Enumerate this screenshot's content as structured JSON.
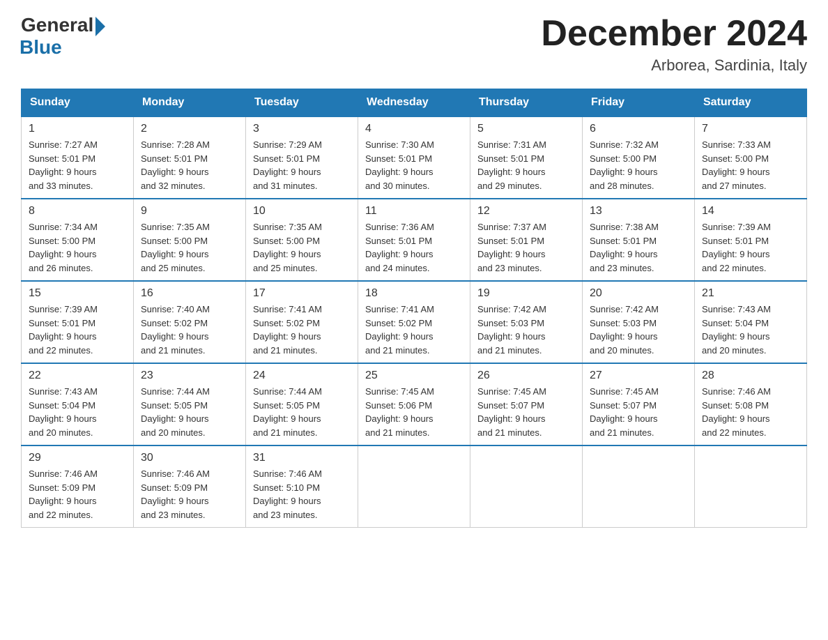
{
  "logo": {
    "general": "General",
    "blue": "Blue"
  },
  "header": {
    "month_year": "December 2024",
    "location": "Arborea, Sardinia, Italy"
  },
  "days_of_week": [
    "Sunday",
    "Monday",
    "Tuesday",
    "Wednesday",
    "Thursday",
    "Friday",
    "Saturday"
  ],
  "weeks": [
    [
      {
        "day": "1",
        "sunrise": "7:27 AM",
        "sunset": "5:01 PM",
        "daylight": "9 hours and 33 minutes."
      },
      {
        "day": "2",
        "sunrise": "7:28 AM",
        "sunset": "5:01 PM",
        "daylight": "9 hours and 32 minutes."
      },
      {
        "day": "3",
        "sunrise": "7:29 AM",
        "sunset": "5:01 PM",
        "daylight": "9 hours and 31 minutes."
      },
      {
        "day": "4",
        "sunrise": "7:30 AM",
        "sunset": "5:01 PM",
        "daylight": "9 hours and 30 minutes."
      },
      {
        "day": "5",
        "sunrise": "7:31 AM",
        "sunset": "5:01 PM",
        "daylight": "9 hours and 29 minutes."
      },
      {
        "day": "6",
        "sunrise": "7:32 AM",
        "sunset": "5:00 PM",
        "daylight": "9 hours and 28 minutes."
      },
      {
        "day": "7",
        "sunrise": "7:33 AM",
        "sunset": "5:00 PM",
        "daylight": "9 hours and 27 minutes."
      }
    ],
    [
      {
        "day": "8",
        "sunrise": "7:34 AM",
        "sunset": "5:00 PM",
        "daylight": "9 hours and 26 minutes."
      },
      {
        "day": "9",
        "sunrise": "7:35 AM",
        "sunset": "5:00 PM",
        "daylight": "9 hours and 25 minutes."
      },
      {
        "day": "10",
        "sunrise": "7:35 AM",
        "sunset": "5:00 PM",
        "daylight": "9 hours and 25 minutes."
      },
      {
        "day": "11",
        "sunrise": "7:36 AM",
        "sunset": "5:01 PM",
        "daylight": "9 hours and 24 minutes."
      },
      {
        "day": "12",
        "sunrise": "7:37 AM",
        "sunset": "5:01 PM",
        "daylight": "9 hours and 23 minutes."
      },
      {
        "day": "13",
        "sunrise": "7:38 AM",
        "sunset": "5:01 PM",
        "daylight": "9 hours and 23 minutes."
      },
      {
        "day": "14",
        "sunrise": "7:39 AM",
        "sunset": "5:01 PM",
        "daylight": "9 hours and 22 minutes."
      }
    ],
    [
      {
        "day": "15",
        "sunrise": "7:39 AM",
        "sunset": "5:01 PM",
        "daylight": "9 hours and 22 minutes."
      },
      {
        "day": "16",
        "sunrise": "7:40 AM",
        "sunset": "5:02 PM",
        "daylight": "9 hours and 21 minutes."
      },
      {
        "day": "17",
        "sunrise": "7:41 AM",
        "sunset": "5:02 PM",
        "daylight": "9 hours and 21 minutes."
      },
      {
        "day": "18",
        "sunrise": "7:41 AM",
        "sunset": "5:02 PM",
        "daylight": "9 hours and 21 minutes."
      },
      {
        "day": "19",
        "sunrise": "7:42 AM",
        "sunset": "5:03 PM",
        "daylight": "9 hours and 21 minutes."
      },
      {
        "day": "20",
        "sunrise": "7:42 AM",
        "sunset": "5:03 PM",
        "daylight": "9 hours and 20 minutes."
      },
      {
        "day": "21",
        "sunrise": "7:43 AM",
        "sunset": "5:04 PM",
        "daylight": "9 hours and 20 minutes."
      }
    ],
    [
      {
        "day": "22",
        "sunrise": "7:43 AM",
        "sunset": "5:04 PM",
        "daylight": "9 hours and 20 minutes."
      },
      {
        "day": "23",
        "sunrise": "7:44 AM",
        "sunset": "5:05 PM",
        "daylight": "9 hours and 20 minutes."
      },
      {
        "day": "24",
        "sunrise": "7:44 AM",
        "sunset": "5:05 PM",
        "daylight": "9 hours and 21 minutes."
      },
      {
        "day": "25",
        "sunrise": "7:45 AM",
        "sunset": "5:06 PM",
        "daylight": "9 hours and 21 minutes."
      },
      {
        "day": "26",
        "sunrise": "7:45 AM",
        "sunset": "5:07 PM",
        "daylight": "9 hours and 21 minutes."
      },
      {
        "day": "27",
        "sunrise": "7:45 AM",
        "sunset": "5:07 PM",
        "daylight": "9 hours and 21 minutes."
      },
      {
        "day": "28",
        "sunrise": "7:46 AM",
        "sunset": "5:08 PM",
        "daylight": "9 hours and 22 minutes."
      }
    ],
    [
      {
        "day": "29",
        "sunrise": "7:46 AM",
        "sunset": "5:09 PM",
        "daylight": "9 hours and 22 minutes."
      },
      {
        "day": "30",
        "sunrise": "7:46 AM",
        "sunset": "5:09 PM",
        "daylight": "9 hours and 23 minutes."
      },
      {
        "day": "31",
        "sunrise": "7:46 AM",
        "sunset": "5:10 PM",
        "daylight": "9 hours and 23 minutes."
      },
      null,
      null,
      null,
      null
    ]
  ],
  "labels": {
    "sunrise": "Sunrise:",
    "sunset": "Sunset:",
    "daylight": "Daylight:"
  }
}
